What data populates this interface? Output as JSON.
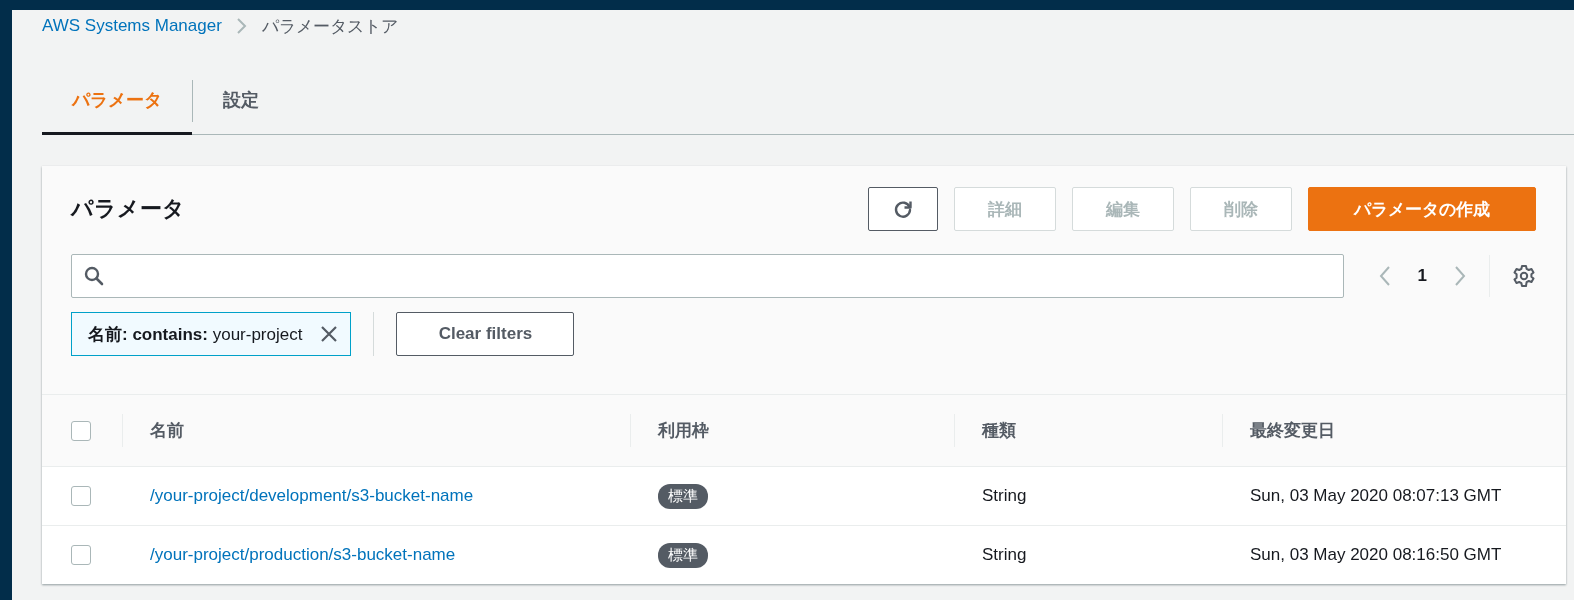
{
  "breadcrumb": [
    {
      "label": "AWS Systems Manager",
      "kind": "link"
    },
    {
      "label": "パラメータストア",
      "kind": "current"
    }
  ],
  "tabs": [
    {
      "label": "パラメータ",
      "selected": true
    },
    {
      "label": "設定",
      "selected": false
    }
  ],
  "panel": {
    "title": "パラメータ",
    "actions": [
      {
        "kind": "refresh"
      },
      {
        "kind": "text",
        "label": "詳細",
        "disabled": true
      },
      {
        "kind": "text",
        "label": "編集",
        "disabled": true
      },
      {
        "kind": "text",
        "label": "削除",
        "disabled": true
      },
      {
        "kind": "primary",
        "label": "パラメータの作成"
      }
    ],
    "pagination": {
      "prev_disabled": true,
      "next_disabled": true,
      "pages": [
        {
          "label": "1"
        }
      ]
    },
    "filter_token": "**名前: contains:** your-project",
    "clear_filters": "Clear filters",
    "table": {
      "select_all_checked": false,
      "columns": [
        "名前",
        "利用枠",
        "種類",
        "最終変更日"
      ],
      "rows": [
        {
          "checked": false,
          "name": "/your-project/development/s3-bucket-name",
          "tier": "標準",
          "type": "String",
          "modified": "Sun, 03 May 2020 08:07:13 GMT"
        },
        {
          "checked": false,
          "name": "/your-project/production/s3-bucket-name",
          "tier": "標準",
          "type": "String",
          "modified": "Sun, 03 May 2020 08:16:50 GMT"
        }
      ]
    }
  }
}
